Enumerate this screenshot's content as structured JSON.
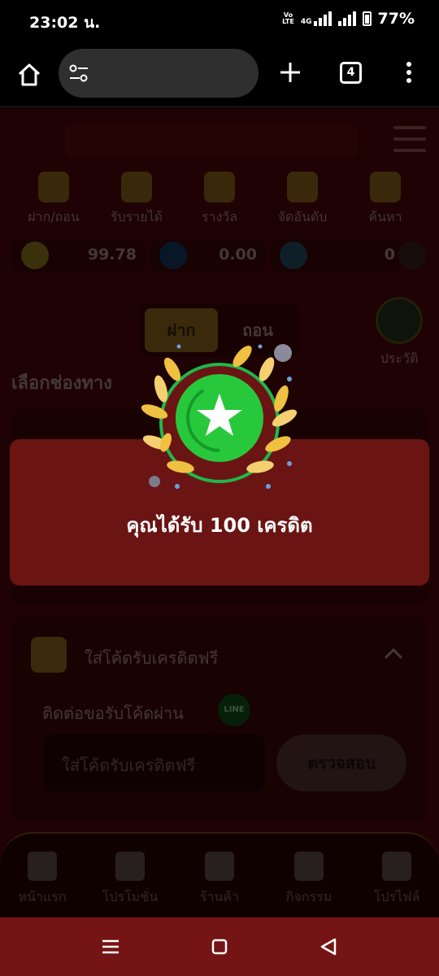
{
  "status_bar": {
    "time": "23:02 น.",
    "network": "4G",
    "volte": "Vo LTE",
    "battery": "77%"
  },
  "browser": {
    "tab_count": "4"
  },
  "quick_actions": [
    {
      "label": "ฝาก/ถอน",
      "icon": "deposit-icon"
    },
    {
      "label": "รับรายได้",
      "icon": "share-icon"
    },
    {
      "label": "รางวัล",
      "icon": "gift-icon"
    },
    {
      "label": "จัดอันดับ",
      "icon": "ranking-icon"
    },
    {
      "label": "ค้นหา",
      "icon": "search-icon"
    }
  ],
  "balances": [
    {
      "value": "99.78",
      "icon": "coin-icon",
      "color": "#6b5a14"
    },
    {
      "value": "0.00",
      "icon": "chip-icon",
      "color": "#102a4a"
    },
    {
      "value": "0",
      "icon": "diamond-icon",
      "color": "#1a3a4a"
    }
  ],
  "tabs": {
    "deposit": "ฝาก",
    "withdraw": "ถอน"
  },
  "history_label": "ประวัติ",
  "choose_channel": "เลือกช่องทาง",
  "promo_code": {
    "title": "ใส่โค้ดรับเครดิตฟรี",
    "contact": "ติดต่อขอรับโค้ดผ่าน",
    "line_badge": "LINE",
    "placeholder": "ใส่โค้ดรับเครดิตฟรี",
    "verify": "ตรวจสอบ"
  },
  "bottom_nav": [
    {
      "label": "หน้าแรก",
      "icon": "home-icon"
    },
    {
      "label": "โปรโมชั่น",
      "icon": "megaphone-icon"
    },
    {
      "label": "ร้านค้า",
      "icon": "shop-icon"
    },
    {
      "label": "กิจกรรม",
      "icon": "medal-icon"
    },
    {
      "label": "โปรไฟล์",
      "icon": "profile-icon"
    }
  ],
  "dialog": {
    "message": "คุณได้รับ 100 เครดิต"
  },
  "colors": {
    "dialog_bg": "#6b1414",
    "badge_green": "#22c43a",
    "laurel_gold": "#f0c040",
    "nav_bar": "#741414"
  }
}
